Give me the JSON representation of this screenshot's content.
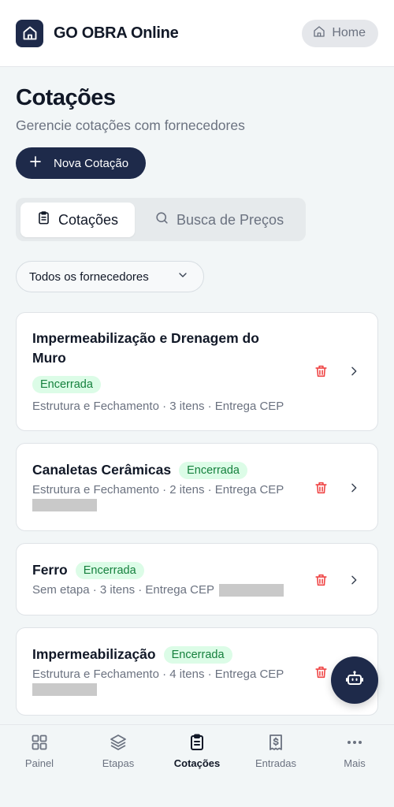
{
  "header": {
    "app_name": "GO OBRA Online",
    "home_label": "Home"
  },
  "page": {
    "title": "Cotações",
    "subtitle": "Gerencie cotações com fornecedores",
    "new_button_label": "Nova Cotação"
  },
  "tabs": [
    {
      "label": "Cotações",
      "icon": "clipboard-icon",
      "active": true
    },
    {
      "label": "Busca de Preços",
      "icon": "search-icon",
      "active": false
    }
  ],
  "filter": {
    "selected": "Todos os fornecedores"
  },
  "quotes": [
    {
      "title_line1": "Impermeabilização e Drenagem do",
      "title_line2": "Muro",
      "status": "Encerrada",
      "meta": "Estrutura e Fechamento · 3 itens · Entrega CEP"
    },
    {
      "title": "Canaletas Cerâmicas",
      "status": "Encerrada",
      "meta": "Estrutura e Fechamento · 2 itens · Entrega CEP"
    },
    {
      "title": "Ferro",
      "status": "Encerrada",
      "meta": "Sem etapa · 3 itens · Entrega CEP"
    },
    {
      "title": "Impermeabilização",
      "status": "Encerrada",
      "meta": "Estrutura e Fechamento · 4 itens · Entrega CEP"
    }
  ],
  "bottom_nav": [
    {
      "label": "Painel",
      "icon": "grid-icon",
      "active": false
    },
    {
      "label": "Etapas",
      "icon": "layers-icon",
      "active": false
    },
    {
      "label": "Cotações",
      "icon": "clipboard-icon",
      "active": true
    },
    {
      "label": "Entradas",
      "icon": "receipt-icon",
      "active": false
    },
    {
      "label": "Mais",
      "icon": "more-dots-icon",
      "active": false
    }
  ],
  "colors": {
    "primary": "#1e2a4a",
    "background": "#f2f6f7",
    "badge_bg": "#dcfce7",
    "badge_text": "#15803d",
    "trash": "#ef4444"
  }
}
